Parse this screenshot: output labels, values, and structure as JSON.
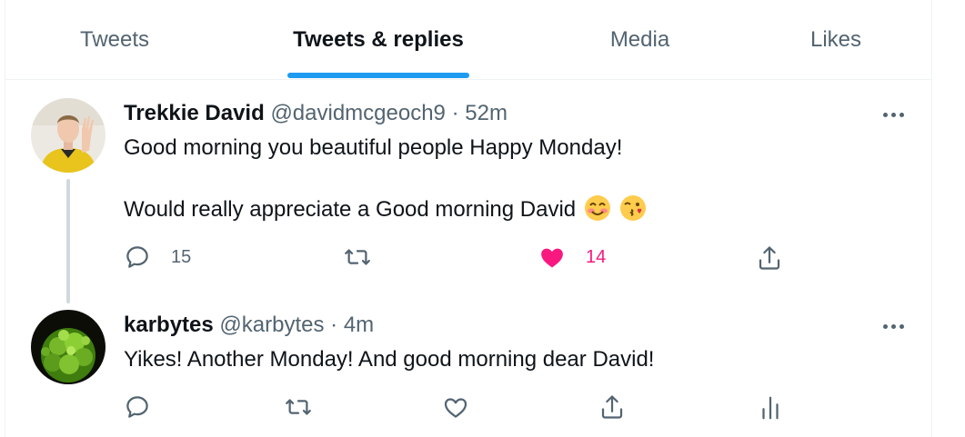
{
  "tabs": [
    {
      "label": "Tweets",
      "active": false
    },
    {
      "label": "Tweets & replies",
      "active": true
    },
    {
      "label": "Media",
      "active": false
    },
    {
      "label": "Likes",
      "active": false
    }
  ],
  "tweets": [
    {
      "name": "Trekkie David",
      "handle": "@davidmcgeoch9",
      "separator": "·",
      "time": "52m",
      "text_line1": "Good morning you beautiful people Happy Monday!",
      "text_line2": "Would really appreciate a Good morning David",
      "emojis": [
        "smiling-face-emoji",
        "face-blowing-kiss-emoji"
      ],
      "reply_count": "15",
      "retweet_count": "",
      "like_count": "14",
      "liked": true
    },
    {
      "name": "karbytes",
      "handle": "@karbytes",
      "separator": "·",
      "time": "4m",
      "text_line1": "Yikes! Another Monday! And good morning dear David!",
      "reply_count": "",
      "retweet_count": "",
      "like_count": "",
      "liked": false
    }
  ],
  "colors": {
    "accent": "#1d9bf0",
    "like": "#f91880",
    "secondary_text": "#536471",
    "border": "#eff3f4"
  }
}
